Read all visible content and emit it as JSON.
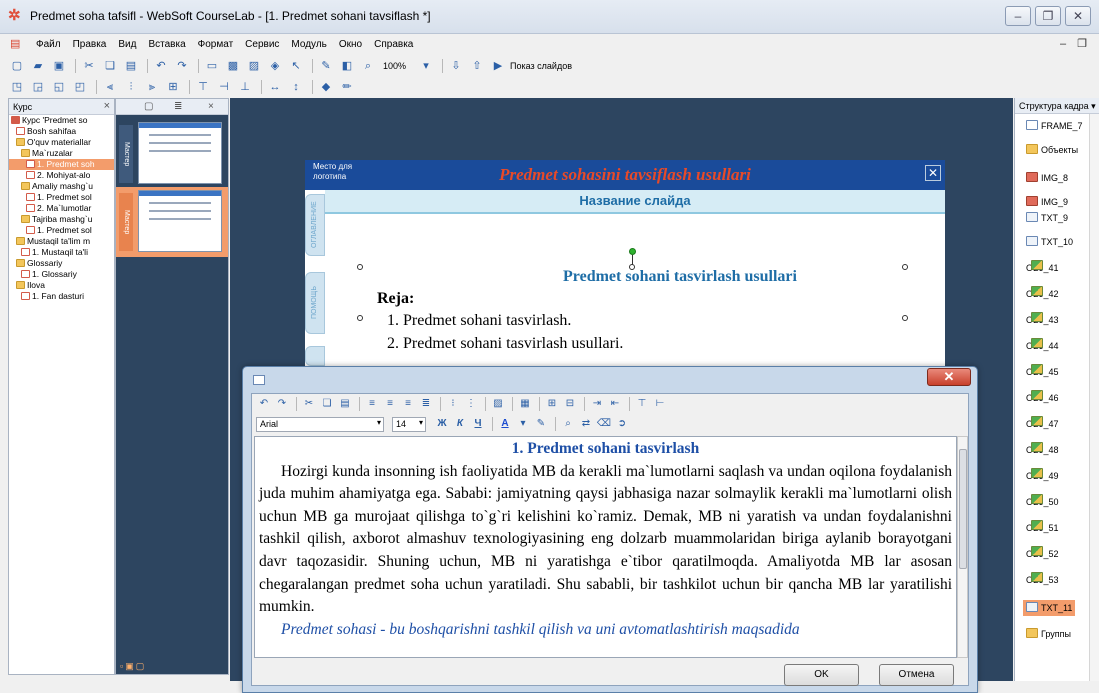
{
  "window": {
    "title": "Predmet soha tafsifl - WebSoft CourseLab - [1. Predmet sohani tavsiflash *]"
  },
  "menu": [
    "Файл",
    "Правка",
    "Вид",
    "Вставка",
    "Формат",
    "Сервис",
    "Модуль",
    "Окно",
    "Справка"
  ],
  "toolbar": {
    "zoom": "100%",
    "slideshow_label": "Показ слайдов"
  },
  "tree_panel": {
    "title": "Курс",
    "items": [
      {
        "label": "Курс 'Predmet so",
        "type": "course",
        "indent": 0
      },
      {
        "label": "Bosh sahifaa",
        "type": "page",
        "indent": 1
      },
      {
        "label": "O'quv materiallar",
        "type": "folder",
        "indent": 1
      },
      {
        "label": "Ma`ruzalar",
        "type": "folder",
        "indent": 2
      },
      {
        "label": "1. Predmet soh",
        "type": "page",
        "indent": 3,
        "selected": true
      },
      {
        "label": "2. Mohiyat-alo",
        "type": "page",
        "indent": 3
      },
      {
        "label": "Amaliy mashg`u",
        "type": "folder",
        "indent": 2
      },
      {
        "label": "1. Predmet sol",
        "type": "page",
        "indent": 3
      },
      {
        "label": "2. Ma`lumotlar",
        "type": "page",
        "indent": 3
      },
      {
        "label": "Tajriba mashg`u",
        "type": "folder",
        "indent": 2
      },
      {
        "label": "1. Predmet sol",
        "type": "page",
        "indent": 3
      },
      {
        "label": "Mustaqil ta'lim m",
        "type": "folder",
        "indent": 1
      },
      {
        "label": "1. Mustaqil ta'li",
        "type": "page",
        "indent": 2
      },
      {
        "label": "Glossariy",
        "type": "folder",
        "indent": 1
      },
      {
        "label": "1. Glossariy",
        "type": "page",
        "indent": 2
      },
      {
        "label": "Ilova",
        "type": "folder",
        "indent": 1
      },
      {
        "label": "1. Fan dasturi",
        "type": "page",
        "indent": 2
      }
    ]
  },
  "thumb_panel": {
    "tab_label_1": "Мастер",
    "tab_label_2": "Мастер"
  },
  "slide": {
    "logo_text_1": "Место для",
    "logo_text_2": "логотипа",
    "header_title": "Predmet sohasini tavsiflash usullari",
    "subtitle": "Название слайда",
    "side_tab_1": "ОГЛАВЛЕНИЕ",
    "side_tab_2": "ПОМОЩЬ",
    "body_title": "Predmet sohani tasvirlash usullari",
    "reja": "Reja:",
    "list": [
      "1.  Predmet sohani tasvirlash.",
      "2.  Predmet sohani tasvirlash usullari."
    ]
  },
  "struct_panel": {
    "title": "Структура кадра",
    "objects": [
      {
        "label": "FRAME_7",
        "type": "frame"
      },
      {
        "label": "Объекты",
        "type": "folder"
      },
      {
        "label": "IMG_8",
        "type": "img"
      },
      {
        "label": "IMG_9",
        "type": "img"
      },
      {
        "label": "TXT_9",
        "type": "txt"
      },
      {
        "label": "TXT_10",
        "type": "txt"
      },
      {
        "label": "OBJ_41",
        "type": "obj"
      },
      {
        "label": "OBJ_42",
        "type": "obj"
      },
      {
        "label": "OBJ_43",
        "type": "obj"
      },
      {
        "label": "OBJ_44",
        "type": "obj"
      },
      {
        "label": "OBJ_45",
        "type": "obj"
      },
      {
        "label": "OBJ_46",
        "type": "obj"
      },
      {
        "label": "OBJ_47",
        "type": "obj"
      },
      {
        "label": "OBJ_48",
        "type": "obj"
      },
      {
        "label": "OBJ_49",
        "type": "obj"
      },
      {
        "label": "OBJ_50",
        "type": "obj"
      },
      {
        "label": "OBJ_51",
        "type": "obj"
      },
      {
        "label": "OBJ_52",
        "type": "obj"
      },
      {
        "label": "OBJ_53",
        "type": "obj"
      },
      {
        "label": "TXT_11",
        "type": "txt",
        "selected": true
      },
      {
        "label": "Группы",
        "type": "folder"
      }
    ]
  },
  "editor": {
    "font": "Arial",
    "size": "14",
    "heading": "1. Predmet sohani tasvirlash",
    "paragraph": "Hozirgi kunda insonning ish faoliyatida MB da kerakli ma`lumotlarni saqlash va undan oqilona foydalanish juda muhim ahamiyatga ega. Sababi: jamiyatning qaysi jabhasiga nazar solmaylik kerakli ma`lumotlarni olish uchun MB ga murojaat qilishga to`g`ri kelishini ko`ramiz. Demak, MB ni yaratish va undan foydalanishni tashkil qilish, axborot almashuv texnologiyasining eng dolzarb muammolaridan biriga aylanib borayotgani davr taqozasidir. Shuning uchun, MB ni yaratishga e`tibor qaratilmoqda. Amaliyotda MB lar asosan chegaralangan predmet soha uchun yaratiladi. Shu sababli, bir tashkilot uchun bir qancha MB lar yaratilishi mumkin.",
    "next_line": "Predmet sohasi - bu boshqarishni tashkil qilish va uni avtomatlashtirish maqsadida",
    "ok_label": "OK",
    "cancel_label": "Отмена"
  }
}
